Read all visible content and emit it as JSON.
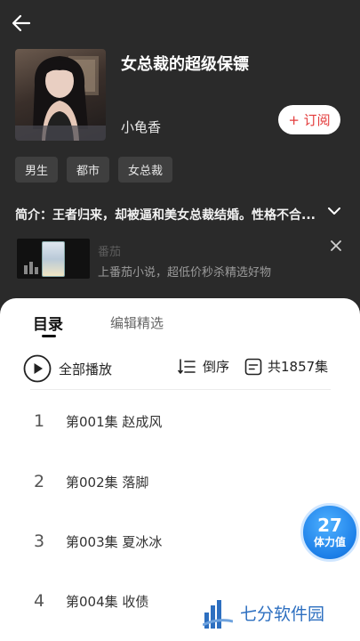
{
  "header": {
    "back_icon": "arrow-left-icon"
  },
  "book": {
    "title": "女总裁的超级保镖",
    "author": "小龟香",
    "subscribe_label": "+ 订阅",
    "tags": [
      "男生",
      "都市",
      "女总裁"
    ],
    "intro": "简介：王者归来，却被逼和美女总裁结婚。性格不合..."
  },
  "ad": {
    "name": "番茄",
    "description": "上番茄小说，超低价秒杀精选好物"
  },
  "catalog": {
    "tab_active": "目录",
    "tab_inactive": "编辑精选",
    "play_all": "全部播放",
    "order": "倒序",
    "total": "共1857集",
    "episodes": [
      {
        "num": "1",
        "name": "第001集  赵成风"
      },
      {
        "num": "2",
        "name": "第002集  落脚"
      },
      {
        "num": "3",
        "name": "第003集  夏冰冰"
      },
      {
        "num": "4",
        "name": "第004集  收债"
      }
    ]
  },
  "stamina": {
    "value": "27",
    "label": "体力值"
  },
  "watermark": {
    "text": "七分软件园"
  },
  "colors": {
    "subscribe": "#e33b3b",
    "badge": "#1c7fe8",
    "background": "#2a2a2a",
    "watermark": "#2d6fc0"
  }
}
